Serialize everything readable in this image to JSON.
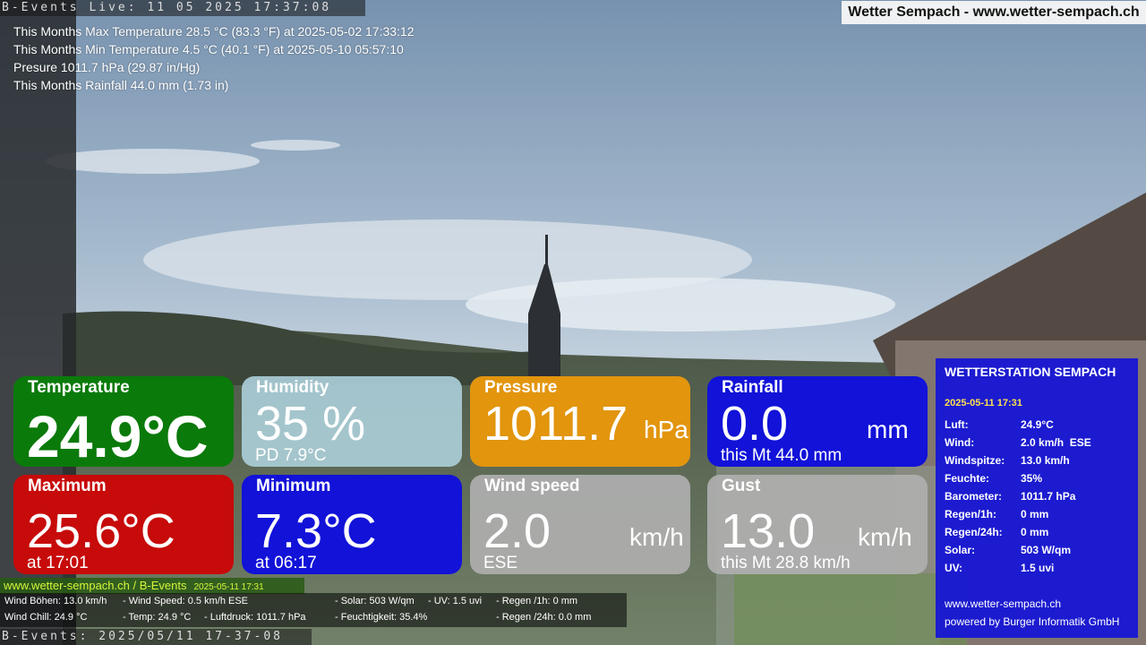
{
  "header": {
    "live_text": "B-Events Live: 11 05 2025 17:37:08",
    "site_title": "Wetter Sempach - www.wetter-sempach.ch"
  },
  "stats": {
    "max_temp": "This Months Max Temperature 28.5 °C (83.3 °F) at 2025-05-02 17:33:12",
    "min_temp": "This Months Min Temperature 4.5 °C (40.1 °F) at 2025-05-10 05:57:10",
    "pressure": "Presure 1011.7 hPa (29.87 in/Hg)",
    "rainfall": "This Months Rainfall 44.0 mm (1.73 in)"
  },
  "tiles": {
    "temperature": {
      "title": "Temperature",
      "value": "24.9°C"
    },
    "humidity": {
      "title": "Humidity",
      "value": "35 %",
      "sub": "PD 7.9°C"
    },
    "pressure": {
      "title": "Pressure",
      "value": "1011.7",
      "unit": "hPa"
    },
    "rainfall": {
      "title": "Rainfall",
      "value": "0.0",
      "unit": "mm",
      "sub": "this Mt 44.0 mm"
    },
    "maximum": {
      "title": "Maximum",
      "value": "25.6°C",
      "sub": "at 17:01"
    },
    "minimum": {
      "title": "Minimum",
      "value": "7.3°C",
      "sub": "at 06:17"
    },
    "wind_speed": {
      "title": "Wind speed",
      "value": "2.0",
      "unit": "km/h",
      "sub": "ESE"
    },
    "gust": {
      "title": "Gust",
      "value": "13.0",
      "unit": "km/h",
      "sub": "this Mt 28.8 km/h"
    }
  },
  "station": {
    "title": "WETTERSTATION SEMPACH",
    "date": "2025-05-11 17:31",
    "rows": [
      {
        "k": "Luft:",
        "v": "24.9°C"
      },
      {
        "k": "Wind:",
        "v": "2.0 km/h  ESE"
      },
      {
        "k": "Windspitze:",
        "v": "13.0 km/h"
      },
      {
        "k": "Feuchte:",
        "v": "35%"
      },
      {
        "k": "Barometer:",
        "v": "1011.7 hPa"
      },
      {
        "k": "Regen/1h:",
        "v": "0 mm"
      },
      {
        "k": "Regen/24h:",
        "v": "0 mm"
      },
      {
        "k": "Solar:",
        "v": "503 W/qm"
      },
      {
        "k": "UV:",
        "v": "1.5 uvi"
      }
    ],
    "footer_url": "www.wetter-sempach.ch",
    "footer_credit": "powered by Burger Informatik GmbH"
  },
  "bottom": {
    "link": "www.wetter-sempach.ch / B-Events",
    "link_date": "2025-05-11 17:31",
    "ticker": {
      "wind_boehen": "Wind Böhen: 13.0 km/h",
      "wind_speed": "- Wind Speed: 0.5 km/h ESE",
      "solar": "- Solar: 503 W/qm",
      "uv": "- UV: 1.5 uvi",
      "regen_1h": "- Regen /1h:   0 mm",
      "wind_chill": "Wind Chill: 24.9 °C",
      "temp": "- Temp: 24.9 °C",
      "luftdruck": "- Luftdruck: 1011.7 hPa",
      "feuchtigkeit": "- Feuchtigkeit: 35.4%",
      "regen_24h": "- Regen /24h: 0.0 mm"
    },
    "bottom_bar": "B-Events: 2025/05/11 17-37-08"
  }
}
